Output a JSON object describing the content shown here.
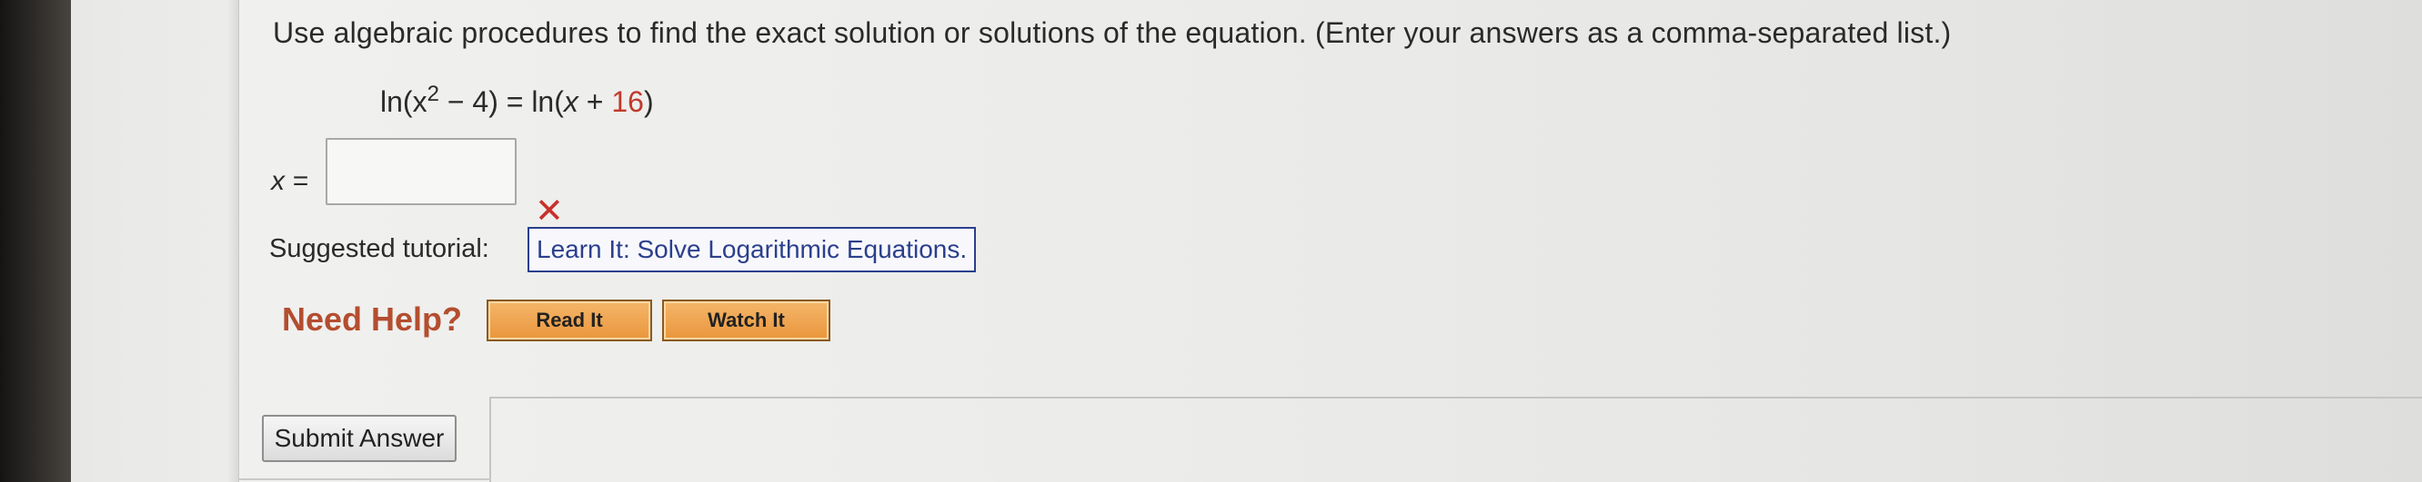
{
  "question": {
    "instruction": "Use algebraic procedures to find the exact solution or solutions of the equation. (Enter your answers as a comma-separated list.)",
    "equation": {
      "lhs_prefix": "ln(x",
      "exponent": "2",
      "lhs_suffix": " − 4) = ln(",
      "variable": "x",
      "plus": " + ",
      "constant": "16",
      "close": ")"
    }
  },
  "answer": {
    "label": "x =",
    "value": "",
    "status": "incorrect",
    "status_icon": "x-mark-icon",
    "status_color": "#c9302c"
  },
  "tutorial": {
    "label": "Suggested tutorial:",
    "link_text": "Learn It: Solve Logarithmic Equations."
  },
  "help": {
    "title": "Need Help?",
    "read_label": "Read It",
    "watch_label": "Watch It"
  },
  "submit": {
    "label": "Submit Answer"
  },
  "colors": {
    "help_button": "#ea963c",
    "link": "#2b3f8c",
    "need_help_text": "#b44d2f",
    "equation_constant": "#c0392b"
  }
}
